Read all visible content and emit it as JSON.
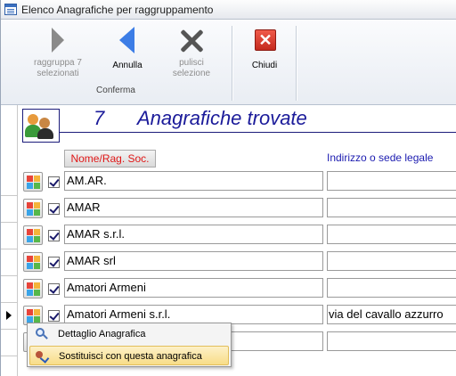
{
  "window": {
    "title": "Elenco Anagrafiche per raggruppamento"
  },
  "ribbon": {
    "group_label": "Conferma",
    "buttons": [
      {
        "label_line1": "raggruppa 7",
        "label_line2": "selezionati",
        "icon": "arrow-right-icon",
        "enabled": false
      },
      {
        "label_line1": "Annulla",
        "label_line2": "",
        "icon": "arrow-left-icon",
        "enabled": true
      },
      {
        "label_line1": "pulisci",
        "label_line2": "selezione",
        "icon": "clear-x-icon",
        "enabled": false
      },
      {
        "label_line1": "Chiudi",
        "label_line2": "",
        "icon": "close-icon",
        "enabled": true
      }
    ]
  },
  "header": {
    "count": "7",
    "found_label": "Anagrafiche trovate",
    "col_name": "Nome/Rag. Soc.",
    "col_address": "Indirizzo o sede legale"
  },
  "rows": [
    {
      "name": "AM.AR.",
      "address": "",
      "checked": true
    },
    {
      "name": "AMAR",
      "address": "",
      "checked": true
    },
    {
      "name": "AMAR s.r.l.",
      "address": "",
      "checked": true
    },
    {
      "name": "AMAR srl",
      "address": "",
      "checked": true
    },
    {
      "name": "Amatori Armeni",
      "address": "",
      "checked": true
    },
    {
      "name": "Amatori Armeni s.r.l.",
      "address": "via del cavallo azzurro",
      "checked": true,
      "current": true
    },
    {
      "name": "",
      "address": "",
      "checked": false
    }
  ],
  "context_menu": {
    "items": [
      {
        "label": "Dettaglio Anagrafica",
        "icon": "magnifier-icon"
      },
      {
        "label": "Sostituisci con questa anagrafica",
        "icon": "replace-icon",
        "highlighted": true
      }
    ]
  },
  "colors": {
    "title_blue": "#1b1b9a",
    "header_red": "#e01818",
    "address_blue": "#1b1bb0"
  }
}
